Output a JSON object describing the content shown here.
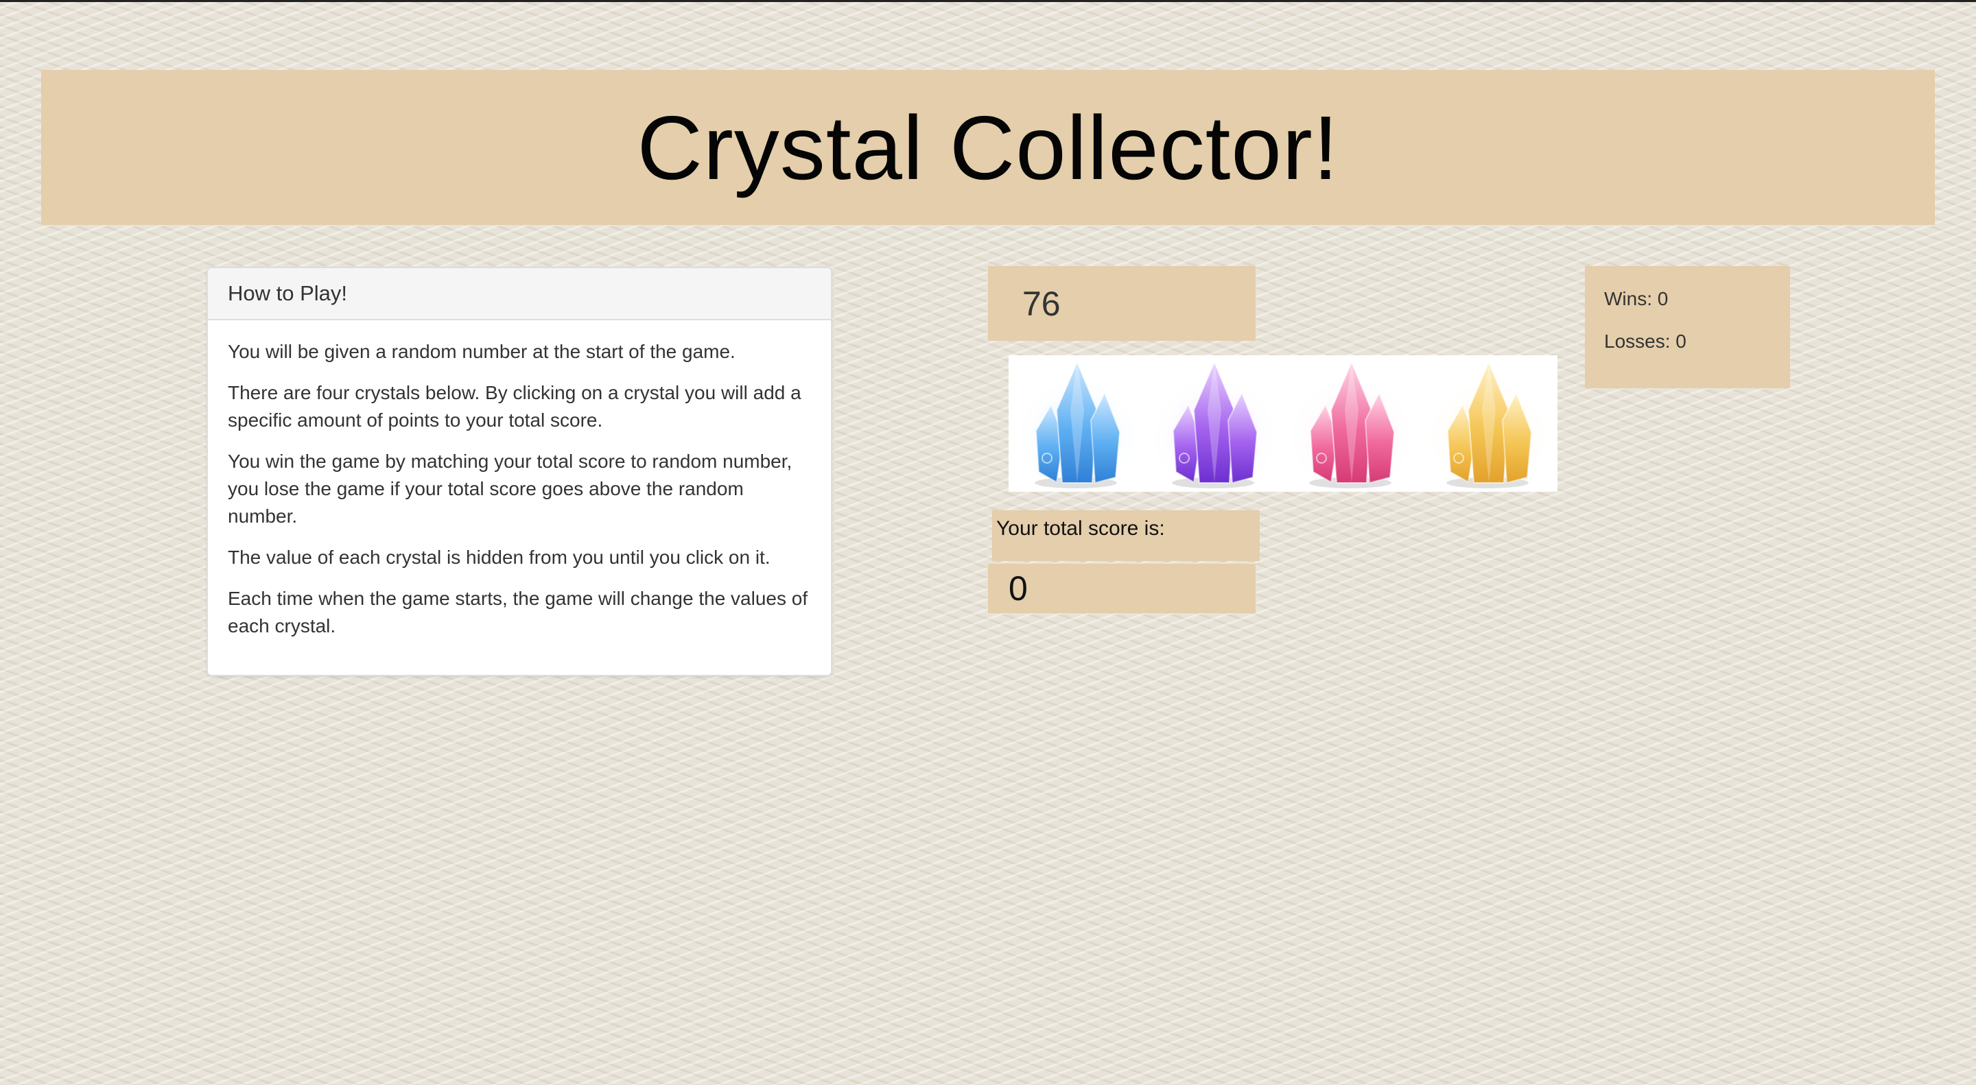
{
  "header": {
    "title": "Crystal Collector!"
  },
  "instructions": {
    "heading": "How to Play!",
    "paragraphs": [
      "You will be given a random number at the start of the game.",
      "There are four crystals below. By clicking on a crystal you will add a specific amount of points to your total score.",
      "You win the game by matching your total score to random number, you lose the game if your total score goes above the random number.",
      "The value of each crystal is hidden from you until you click on it.",
      "Each time when the game starts, the game will change the values of each crystal."
    ]
  },
  "game": {
    "target_number": "76",
    "score_label": "Your total score is:",
    "total_score": "0",
    "crystals": [
      {
        "icon": "blue-crystal-icon",
        "color": "#4aa3ef"
      },
      {
        "icon": "purple-crystal-icon",
        "color": "#9b4fe6"
      },
      {
        "icon": "pink-crystal-icon",
        "color": "#ef5a94"
      },
      {
        "icon": "yellow-crystal-icon",
        "color": "#f3c14d"
      }
    ]
  },
  "stats": {
    "wins": "Wins: 0",
    "losses": "Losses: 0"
  },
  "colors": {
    "accent": "#e4ceab",
    "background": "#e8e3d8"
  }
}
